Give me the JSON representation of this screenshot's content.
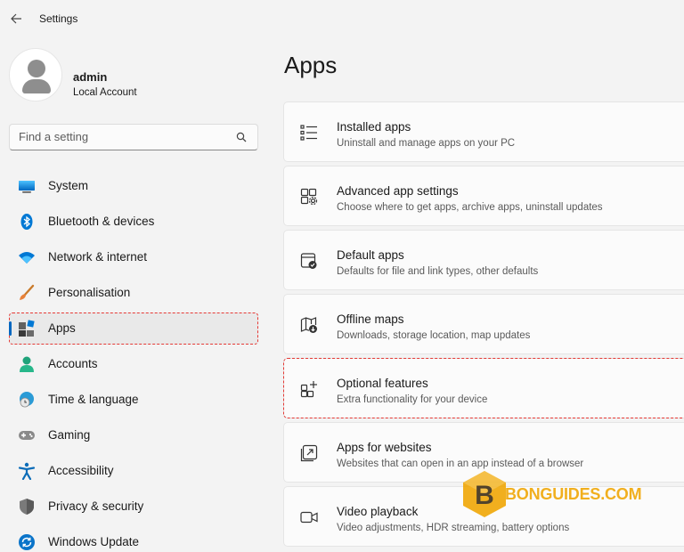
{
  "app": {
    "title": "Settings"
  },
  "profile": {
    "name": "admin",
    "account_type": "Local Account"
  },
  "search": {
    "placeholder": "Find a setting",
    "icon": "search-icon"
  },
  "sidebar": {
    "items": [
      {
        "label": "System",
        "icon": "system-icon"
      },
      {
        "label": "Bluetooth & devices",
        "icon": "bluetooth-icon"
      },
      {
        "label": "Network & internet",
        "icon": "wifi-icon"
      },
      {
        "label": "Personalisation",
        "icon": "brush-icon"
      },
      {
        "label": "Apps",
        "icon": "apps-icon",
        "active": true
      },
      {
        "label": "Accounts",
        "icon": "person-icon"
      },
      {
        "label": "Time & language",
        "icon": "globe-clock-icon"
      },
      {
        "label": "Gaming",
        "icon": "gamepad-icon"
      },
      {
        "label": "Accessibility",
        "icon": "accessibility-icon"
      },
      {
        "label": "Privacy & security",
        "icon": "shield-icon"
      },
      {
        "label": "Windows Update",
        "icon": "update-icon"
      }
    ]
  },
  "main": {
    "title": "Apps",
    "cards": [
      {
        "title": "Installed apps",
        "subtitle": "Uninstall and manage apps on your PC",
        "icon": "list-icon"
      },
      {
        "title": "Advanced app settings",
        "subtitle": "Choose where to get apps, archive apps, uninstall updates",
        "icon": "app-settings-icon"
      },
      {
        "title": "Default apps",
        "subtitle": "Defaults for file and link types, other defaults",
        "icon": "default-apps-icon"
      },
      {
        "title": "Offline maps",
        "subtitle": "Downloads, storage location, map updates",
        "icon": "map-download-icon"
      },
      {
        "title": "Optional features",
        "subtitle": "Extra functionality for your device",
        "icon": "add-feature-icon"
      },
      {
        "title": "Apps for websites",
        "subtitle": "Websites that can open in an app instead of a browser",
        "icon": "open-link-icon"
      },
      {
        "title": "Video playback",
        "subtitle": "Video adjustments, HDR streaming, battery options",
        "icon": "video-icon"
      }
    ]
  },
  "watermark": {
    "text": "BONGUIDES.COM"
  },
  "colors": {
    "accent": "#0067c0",
    "highlight_border": "#e53935",
    "watermark": "#f0a500"
  }
}
